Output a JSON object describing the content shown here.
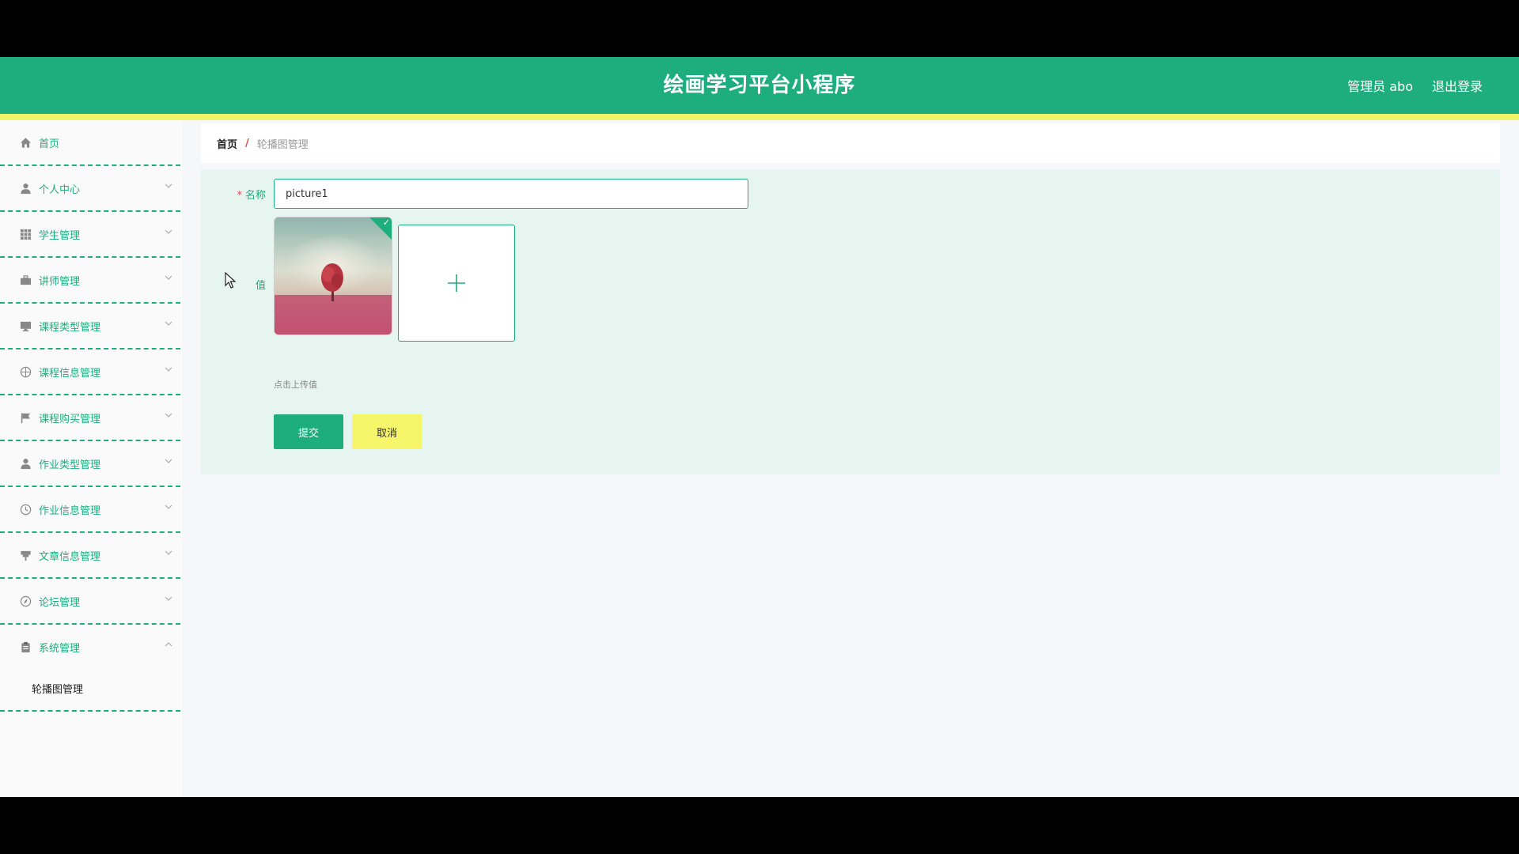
{
  "header": {
    "title": "绘画学习平台小程序",
    "user": "管理员 abo",
    "logout": "退出登录"
  },
  "sidebar": {
    "items": [
      {
        "label": "首页",
        "icon": "home-icon",
        "has_children": false
      },
      {
        "label": "个人中心",
        "icon": "user-icon",
        "has_children": true
      },
      {
        "label": "学生管理",
        "icon": "grid-icon",
        "has_children": true
      },
      {
        "label": "讲师管理",
        "icon": "briefcase-icon",
        "has_children": true
      },
      {
        "label": "课程类型管理",
        "icon": "monitor-icon",
        "has_children": true
      },
      {
        "label": "课程信息管理",
        "icon": "globe-icon",
        "has_children": true
      },
      {
        "label": "课程购买管理",
        "icon": "flag-icon",
        "has_children": true
      },
      {
        "label": "作业类型管理",
        "icon": "user-icon",
        "has_children": true
      },
      {
        "label": "作业信息管理",
        "icon": "clock-icon",
        "has_children": true
      },
      {
        "label": "文章信息管理",
        "icon": "podium-icon",
        "has_children": true
      },
      {
        "label": "论坛管理",
        "icon": "compass-icon",
        "has_children": true
      },
      {
        "label": "系统管理",
        "icon": "clipboard-icon",
        "has_children": true,
        "expanded": true
      }
    ],
    "sub_items": [
      {
        "label": "轮播图管理"
      }
    ]
  },
  "breadcrumb": {
    "home": "首页",
    "separator": "/",
    "current": "轮播图管理"
  },
  "form": {
    "name_label": "名称",
    "name_value": "picture1",
    "value_label": "值",
    "upload_tip": "点击上传值",
    "submit_label": "提交",
    "cancel_label": "取消"
  },
  "colors": {
    "primary": "#1ead7c",
    "accent_strip": "#f1f466",
    "cancel_button": "#f7f56a",
    "form_background": "#e6f5ef",
    "required_star": "#e04b4b"
  }
}
